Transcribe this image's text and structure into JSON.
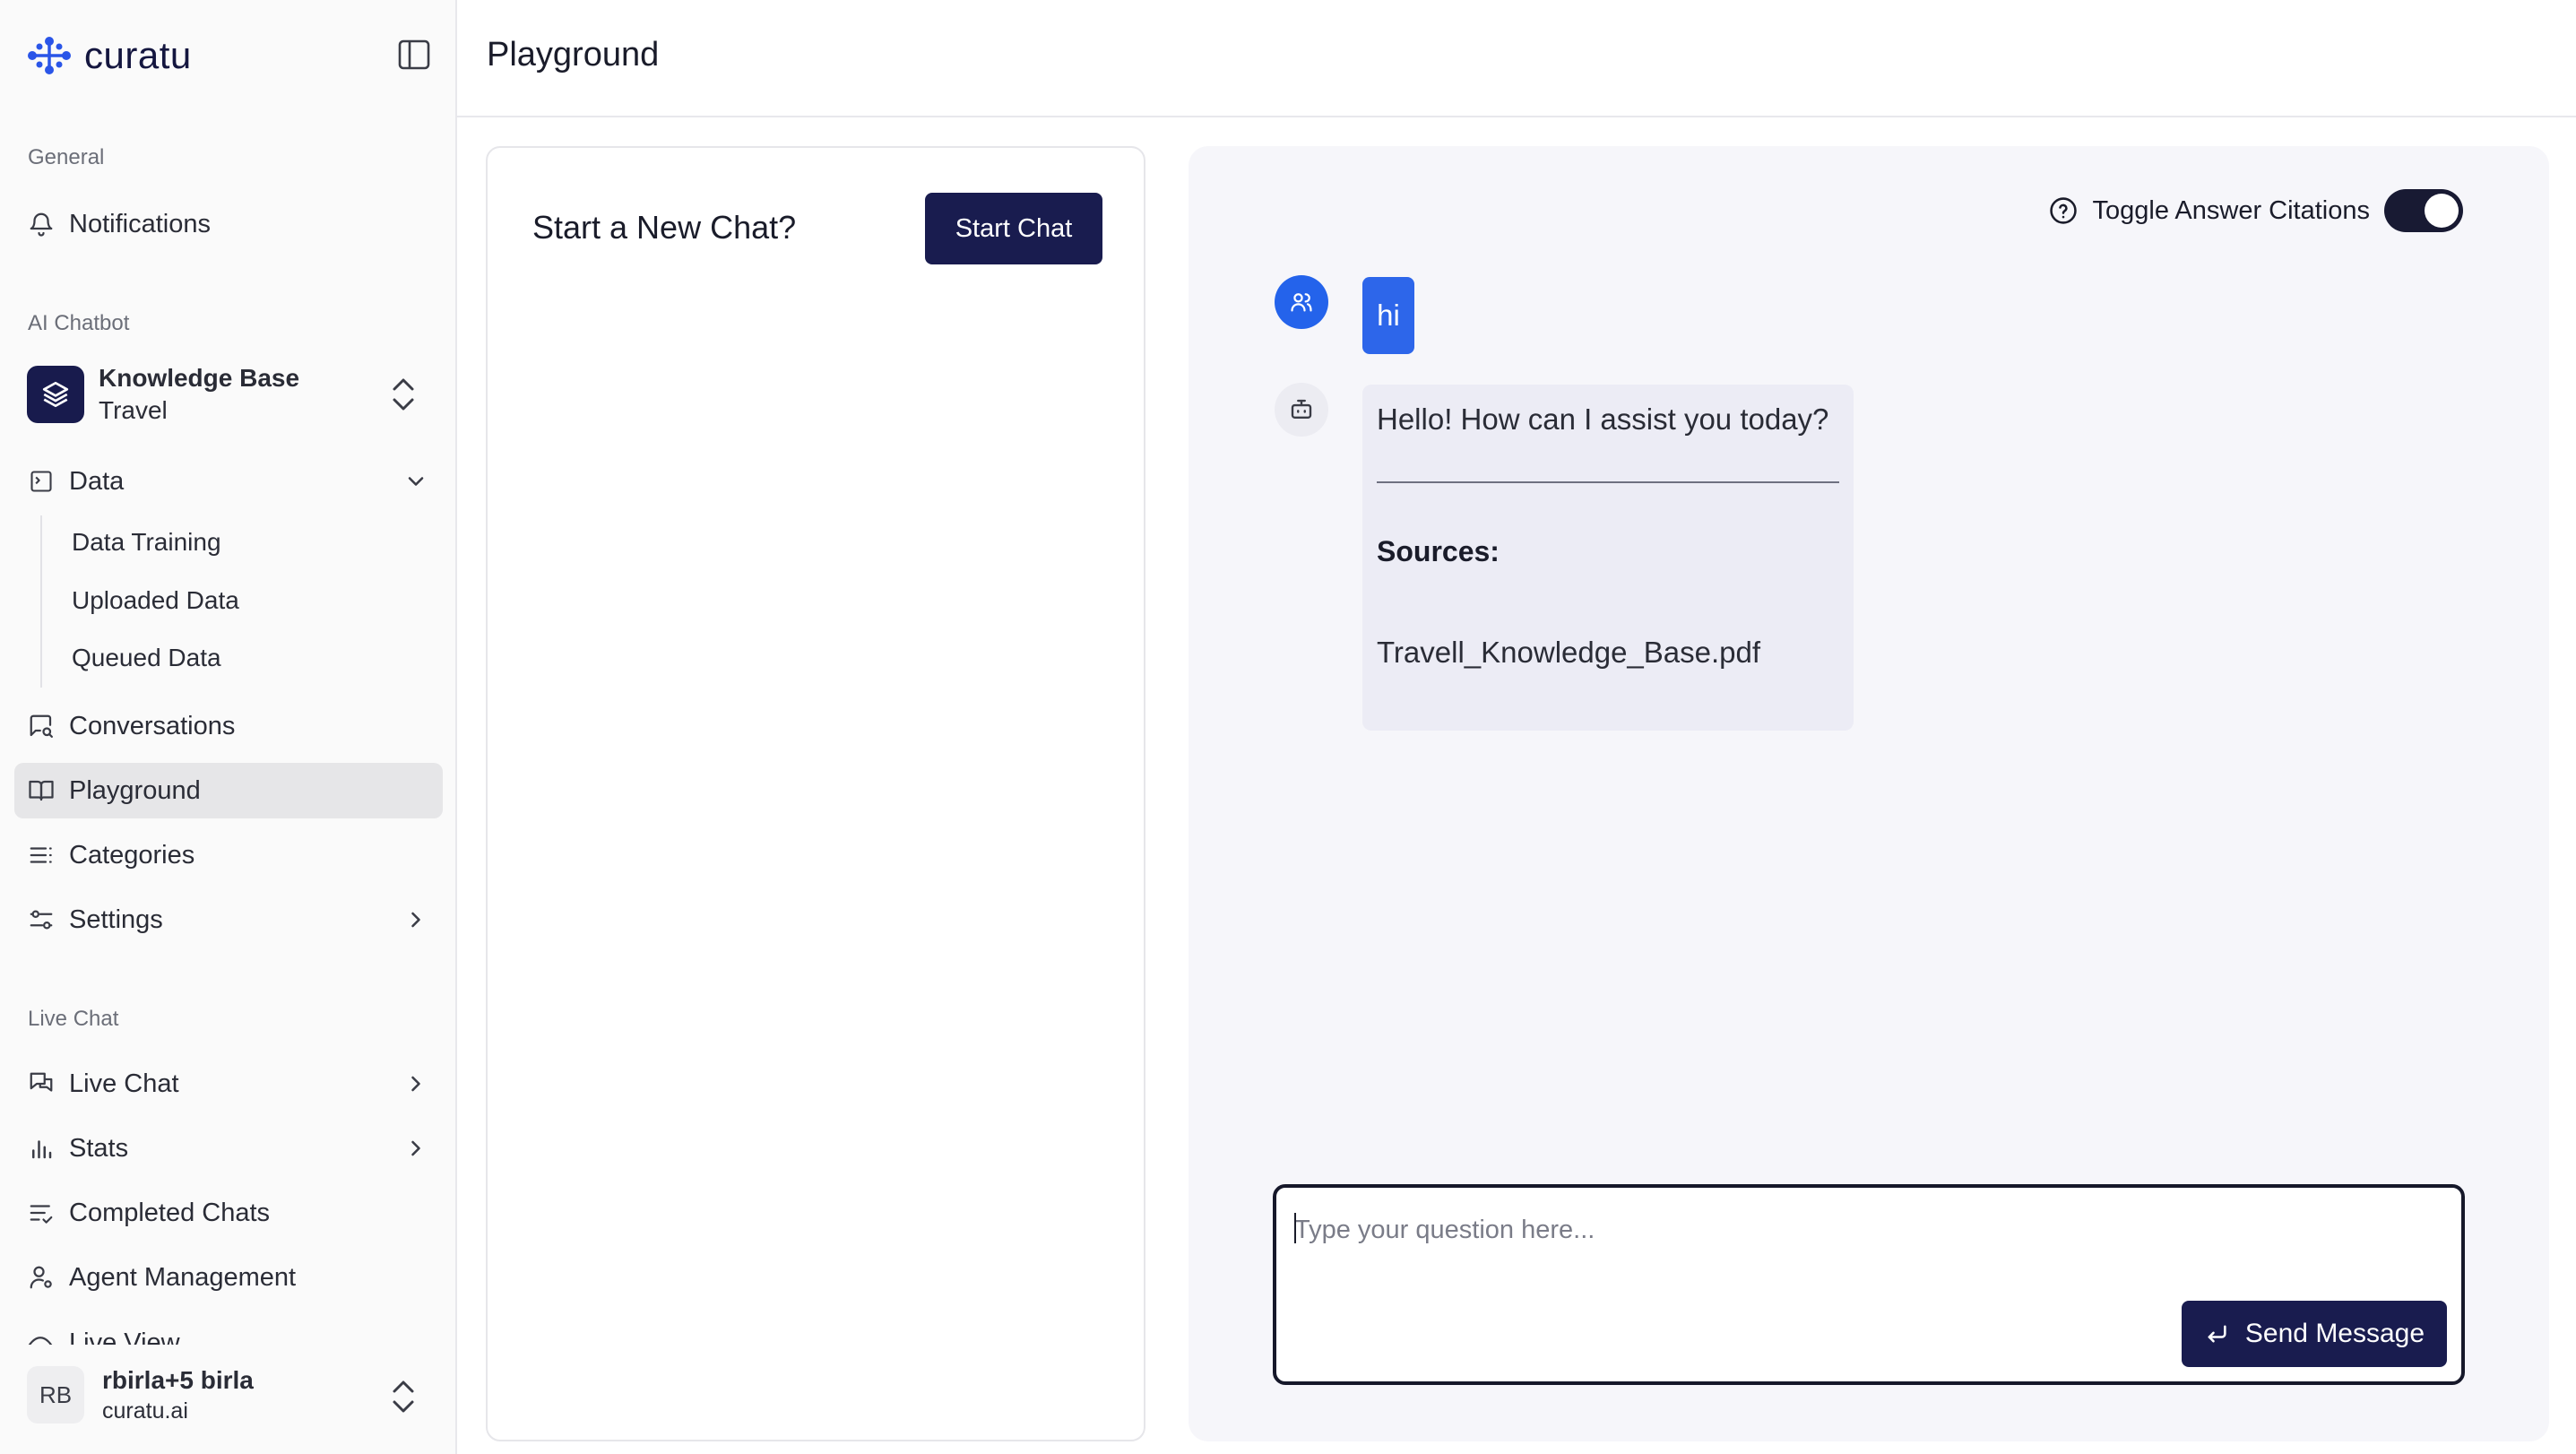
{
  "brand": {
    "name": "curatu",
    "accent": "#181b4d",
    "link_blue": "#2463eb"
  },
  "sidebar": {
    "sections": {
      "general": "General",
      "ai_chatbot": "AI Chatbot",
      "live_chat": "Live Chat"
    },
    "notifications": "Notifications",
    "knowledge_base": {
      "title": "Knowledge Base",
      "subtitle": "Travel"
    },
    "data": {
      "label": "Data",
      "children": [
        "Data Training",
        "Uploaded Data",
        "Queued Data"
      ]
    },
    "conversations": "Conversations",
    "playground": "Playground",
    "categories": "Categories",
    "settings": "Settings",
    "live_chat": "Live Chat",
    "stats": "Stats",
    "completed_chats": "Completed Chats",
    "agent_management": "Agent Management",
    "live_view": "Live View",
    "user": {
      "initials": "RB",
      "name": "rbirla+5 birla",
      "org": "curatu.ai"
    }
  },
  "header": {
    "title": "Playground"
  },
  "new_chat": {
    "title": "Start a New Chat?",
    "button": "Start Chat"
  },
  "chat": {
    "toggle_label": "Toggle Answer Citations",
    "toggle_on": true,
    "messages": {
      "user": "hi",
      "bot": {
        "greeting": "Hello! How can I assist you today?",
        "sources_label": "Sources:",
        "source_file": "Travell_Knowledge_Base.pdf"
      }
    },
    "composer": {
      "placeholder": "Type your question here...",
      "value": "",
      "send_label": "Send Message"
    }
  }
}
